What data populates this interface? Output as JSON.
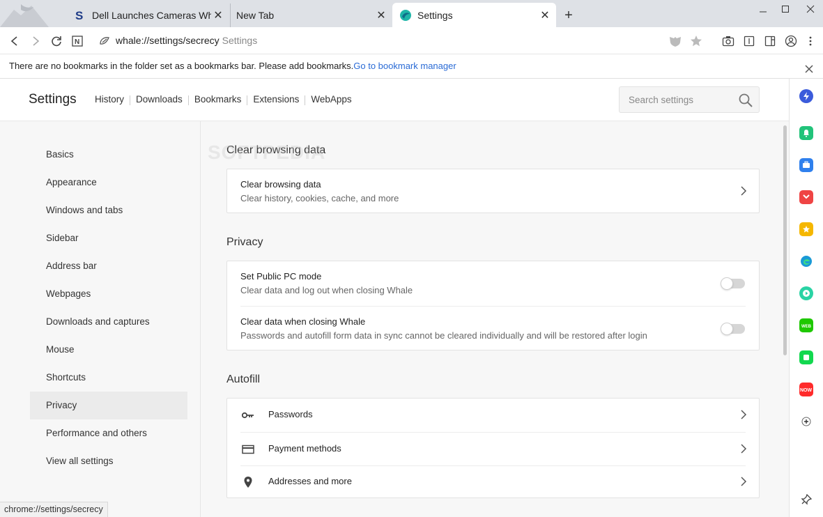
{
  "tabs": [
    {
      "title": "Dell Launches Cameras Whose",
      "active": false
    },
    {
      "title": "New Tab",
      "active": false
    },
    {
      "title": "Settings",
      "active": true
    }
  ],
  "url": {
    "main": "whale://settings/secrecy",
    "suffix": "Settings"
  },
  "bookmark_bar": {
    "message": "There are no bookmarks in the folder set as a bookmarks bar. Please add bookmarks.",
    "link": "Go to bookmark manager"
  },
  "header": {
    "title": "Settings",
    "nav": [
      "History",
      "Downloads",
      "Bookmarks",
      "Extensions",
      "WebApps"
    ],
    "search_placeholder": "Search settings"
  },
  "sidebar": {
    "items": [
      "Basics",
      "Appearance",
      "Windows and tabs",
      "Sidebar",
      "Address bar",
      "Webpages",
      "Downloads and captures",
      "Mouse",
      "Shortcuts",
      "Privacy",
      "Performance and others",
      "View all settings"
    ],
    "active": "Privacy"
  },
  "sections": {
    "clear": {
      "title": "Clear browsing data",
      "row_title": "Clear browsing data",
      "row_sub": "Clear history, cookies, cache, and more"
    },
    "privacy": {
      "title": "Privacy",
      "public_pc_title": "Set Public PC mode",
      "public_pc_sub": "Clear data and log out when closing Whale",
      "public_pc_on": false,
      "clear_close_title": "Clear data when closing Whale",
      "clear_close_sub": "Passwords and autofill form data in sync cannot be cleared individually and will be restored after login",
      "clear_close_on": false
    },
    "autofill": {
      "title": "Autofill",
      "passwords": "Passwords",
      "payment": "Payment methods",
      "addresses": "Addresses and more"
    }
  },
  "status_text": "chrome://settings/secrecy",
  "watermark": "SOFTPEDIA",
  "colors": {
    "accent": "#2a6bd6",
    "active_tab": "#ffffff",
    "tabstrip": "#dee1e6"
  }
}
